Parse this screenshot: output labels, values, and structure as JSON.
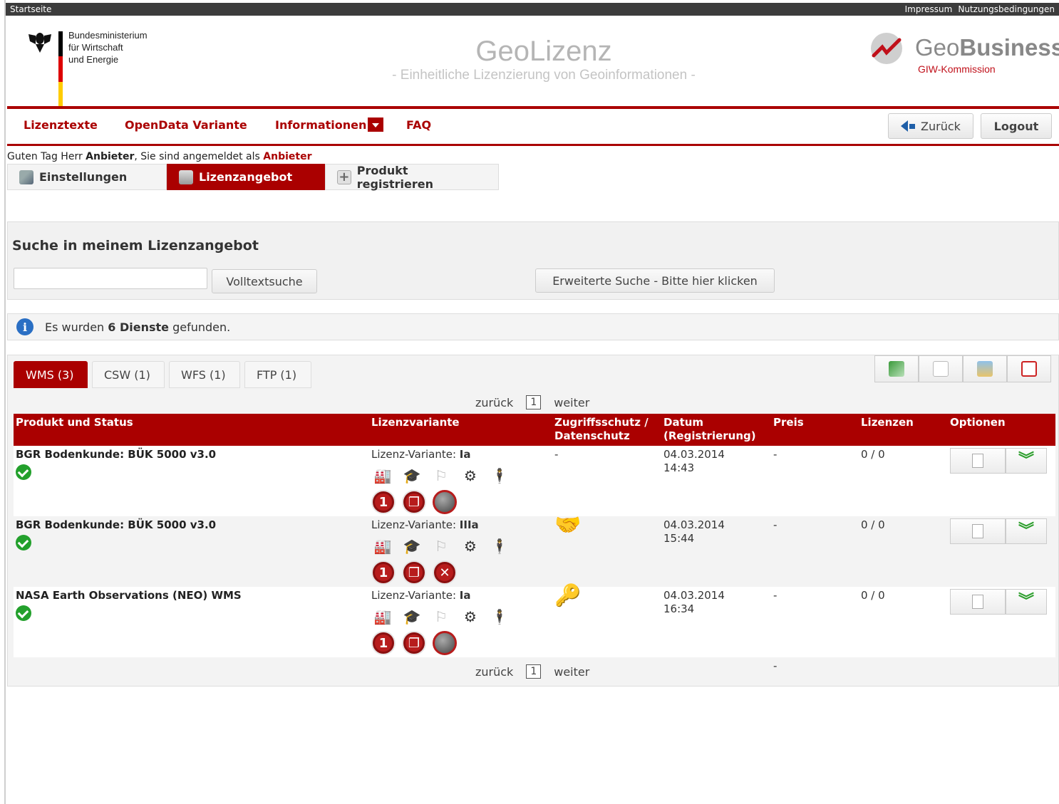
{
  "topbar": {
    "home": "Startseite",
    "links": [
      "Impressum",
      "Nutzungsbedingungen"
    ]
  },
  "header": {
    "ministry": [
      "Bundesministerium",
      "für Wirtschaft",
      "und Energie"
    ],
    "title": "GeoLizenz",
    "subtitle": "- Einheitliche Lizenzierung von Geoinformationen -",
    "brand_geo": "Geo",
    "brand_business": "Business",
    "brand_sub": "GIW-Kommission",
    "colors": {
      "accent": "#aa0000",
      "flag": [
        "#000000",
        "#dd0000",
        "#ffcc00"
      ]
    }
  },
  "nav": {
    "items": [
      "Lizenztexte",
      "OpenData Variante",
      "Informationen",
      "FAQ"
    ],
    "back_label": "Zurück",
    "logout_label": "Logout"
  },
  "greeting": {
    "prefix": "Guten Tag Herr ",
    "name": "Anbieter",
    "middle": ", Sie sind angemeldet als ",
    "role": "Anbieter"
  },
  "user_tabs": [
    "Einstellungen",
    "Lizenzangebot",
    "Produkt registrieren"
  ],
  "search": {
    "heading": "Suche in meinem Lizenzangebot",
    "input_value": "",
    "fulltext_label": "Volltextsuche",
    "advanced_label": "Erweiterte Suche - Bitte hier klicken"
  },
  "info": {
    "prefix": "Es wurden ",
    "count": "6 Dienste",
    "suffix": " gefunden."
  },
  "service_tabs": [
    "WMS (3)",
    "CSW (1)",
    "WFS (1)",
    "FTP (1)"
  ],
  "export_icons": [
    "excel-icon",
    "text-icon",
    "image-icon",
    "pdf-icon"
  ],
  "pager": {
    "prev": "zurück",
    "page": "1",
    "next": "weiter"
  },
  "table": {
    "headers": [
      "Produkt und Status",
      "Lizenzvariante",
      "Zugriffsschutz / Datenschutz",
      "Datum (Registrierung)",
      "Preis",
      "Lizenzen",
      "Optionen"
    ],
    "variant_prefix": "Lizenz-Variante: ",
    "rows": [
      {
        "product": "BGR Bodenkunde: BÜK 5000 v3.0",
        "variant": "Ia",
        "access": "-",
        "date": "04.03.2014",
        "time": "14:43",
        "price": "-",
        "licenses": "0 / 0"
      },
      {
        "product": "BGR Bodenkunde: BÜK 5000 v3.0",
        "variant": "IIIa",
        "access": "",
        "date": "04.03.2014",
        "time": "15:44",
        "price": "-",
        "licenses": "0 / 0"
      },
      {
        "product": "NASA Earth Observations (NEO) WMS",
        "variant": "Ia",
        "access": "",
        "date": "04.03.2014",
        "time": "16:34",
        "price": "-",
        "licenses": "0 / 0"
      }
    ],
    "footer_dash": "-"
  }
}
